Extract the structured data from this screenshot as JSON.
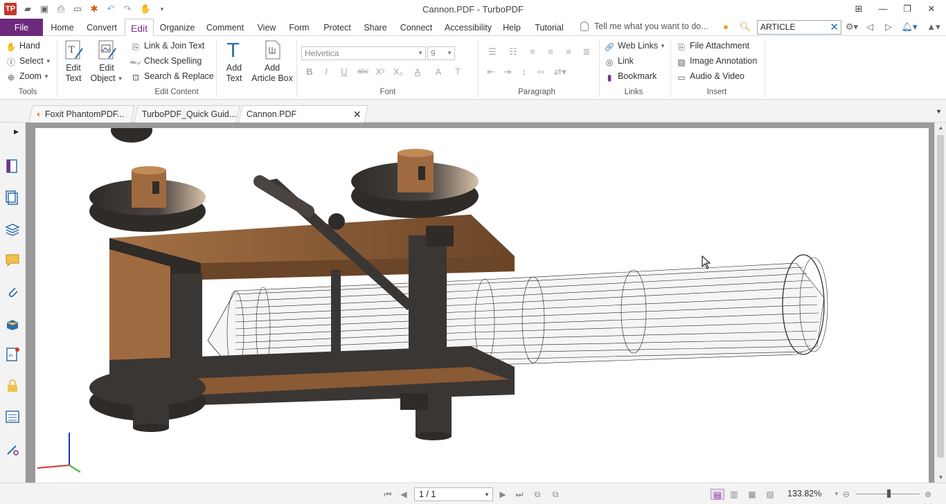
{
  "window": {
    "title": "Cannon.PDF - TurboPDF",
    "logo_text": "TP"
  },
  "quick_access": [
    "open-icon",
    "save-icon",
    "print-icon",
    "properties-icon",
    "new-icon",
    "undo-icon",
    "redo-icon",
    "hand-tool-icon",
    "customize-icon"
  ],
  "menu": {
    "tabs": [
      "File",
      "Home",
      "Convert",
      "Edit",
      "Organize",
      "Comment",
      "View",
      "Form",
      "Protect",
      "Share",
      "Connect",
      "Accessibility",
      "Help",
      "Tutorial"
    ],
    "active_tab": "Edit",
    "tell_me": "Tell me what you want to do...",
    "search_value": "ARTICLE"
  },
  "ribbon": {
    "tools": {
      "hand": "Hand",
      "select": "Select",
      "zoom": "Zoom",
      "label": "Tools"
    },
    "edit_content": {
      "edit_text_1": "Edit",
      "edit_text_2": "Text",
      "edit_object_1": "Edit",
      "edit_object_2": "Object",
      "link_join": "Link & Join Text",
      "check_spelling": "Check Spelling",
      "search_replace": "Search & Replace",
      "label": "Edit Content"
    },
    "insert_text": {
      "add_text_1": "Add",
      "add_text_2": "Text",
      "add_article_1": "Add",
      "add_article_2": "Article Box"
    },
    "font": {
      "family": "Helvetica",
      "size": "9",
      "label": "Font",
      "bold": "B",
      "italic": "I",
      "underline": "U",
      "strike": "abc",
      "superscript": "X²",
      "subscript": "X₂",
      "color": "A",
      "highlight": "A",
      "text_style": "T"
    },
    "paragraph": {
      "label": "Paragraph"
    },
    "links": {
      "web_links": "Web Links",
      "link": "Link",
      "bookmark": "Bookmark",
      "label": "Links"
    },
    "insert": {
      "file_attachment": "File Attachment",
      "image_annotation": "Image Annotation",
      "audio_video": "Audio & Video",
      "label": "Insert"
    }
  },
  "doc_tabs": [
    {
      "label": "Foxit PhantomPDF..."
    },
    {
      "label": "TurboPDF_Quick Guid..."
    },
    {
      "label": "Cannon.PDF"
    }
  ],
  "status": {
    "page": "1 / 1",
    "zoom": "133.82%"
  },
  "colors": {
    "file_tab": "#6d2a7c",
    "active_tab_text": "#7a3189",
    "wood": "#a06a40",
    "wood_dark": "#3a3634"
  }
}
